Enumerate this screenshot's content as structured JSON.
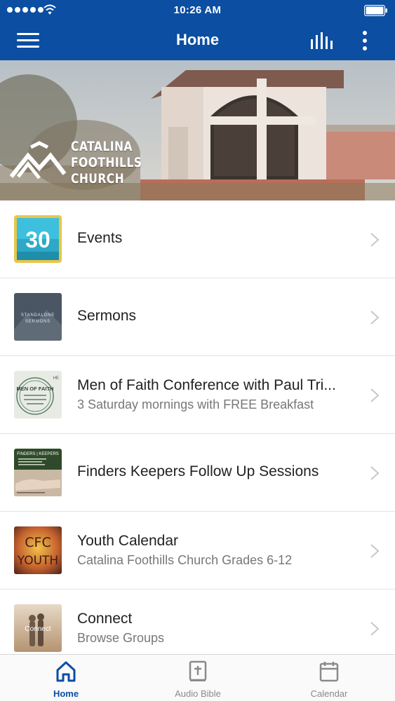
{
  "status_bar": {
    "time": "10:26 AM"
  },
  "header": {
    "title": "Home"
  },
  "banner": {
    "brand_name": [
      "CATALINA",
      "FOOTHILLS",
      "CHURCH"
    ]
  },
  "list": [
    {
      "title": "Events",
      "subtitle": "",
      "thumb_label": "30"
    },
    {
      "title": "Sermons",
      "subtitle": "",
      "thumb_label": "STANDALONE SERMONS"
    },
    {
      "title": "Men of Faith Conference with Paul Tri...",
      "subtitle": "3 Saturday mornings with FREE Breakfast",
      "thumb_label": "MEN OF FAITH"
    },
    {
      "title": "Finders Keepers Follow Up Sessions",
      "subtitle": "",
      "thumb_label": "FINDERS | KEEPERS"
    },
    {
      "title": "Youth Calendar",
      "subtitle": "Catalina Foothills Church Grades 6-12",
      "thumb_label": [
        "CFC",
        "YOUTH"
      ]
    },
    {
      "title": "Connect",
      "subtitle": "Browse Groups",
      "thumb_label": "Connect"
    }
  ],
  "tabs": [
    {
      "label": "Home",
      "icon": "home-icon",
      "active": true
    },
    {
      "label": "Audio Bible",
      "icon": "bible-icon",
      "active": false
    },
    {
      "label": "Calendar",
      "icon": "calendar-icon",
      "active": false
    }
  ],
  "colors": {
    "primary": "#0b4ea2",
    "tab_inactive": "#8a8a8a",
    "divider": "#e3e3e3"
  }
}
